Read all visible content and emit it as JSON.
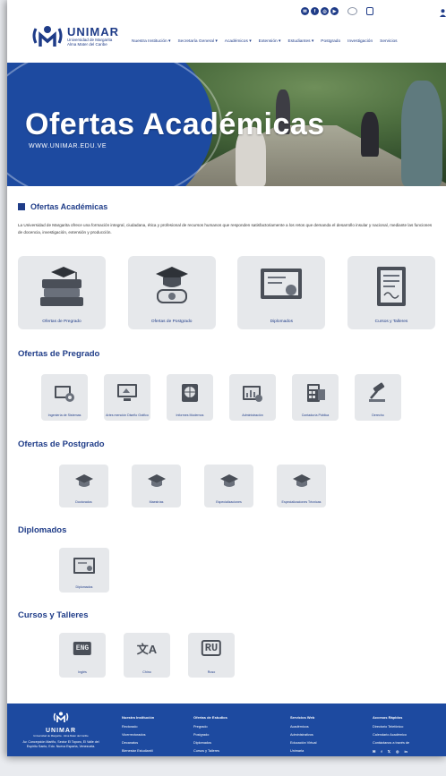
{
  "header": {
    "logo_title": "UNIMAR",
    "logo_sub1": "Universidad de Margarita",
    "logo_sub2": "Alma Mater del Caribe",
    "nav": [
      "Nuestra Institución ▾",
      "Secretaría General ▾",
      "Académicos ▾",
      "Extensión ▾",
      "Estudiantes ▾",
      "Postgrado",
      "Investigación",
      "Servicios"
    ],
    "social": [
      "✉",
      "f",
      "◎",
      "▶"
    ]
  },
  "hero": {
    "title": "Ofertas Académicas",
    "url": "WWW.UNIMAR.EDU.VE"
  },
  "main": {
    "section_title": "Ofertas Académicas",
    "intro": "La Universidad de Margarita ofrece una formación integral, ciudadana, ética y profesional de recursos humanos que responden satisfactoriamente a los retos que demanda el desarrollo insular y nacional, mediante las funciones de docencia, investigación, extensión y producción.",
    "big_cards": [
      "Ofertas de Pregrado",
      "Ofertas de Postgrado",
      "Diplomados",
      "Cursos y Talleres"
    ]
  },
  "pregrado": {
    "title": "Ofertas de Pregrado",
    "cards": [
      "Ingeniería de Sistemas",
      "Artes mención Diseño Gráfico",
      "Informes Modernos",
      "Administración",
      "Contaduría Pública",
      "Derecho"
    ]
  },
  "postgrado": {
    "title": "Ofertas de Postgrado",
    "cards": [
      "Doctorados",
      "Maestrías",
      "Especializaciones",
      "Especializaciones Técnicas"
    ]
  },
  "diplomados": {
    "title": "Diplomados",
    "cards": [
      "Diplomados"
    ]
  },
  "cursos": {
    "title": "Cursos y Talleres",
    "cards": [
      {
        "label": "Inglés",
        "glyph": "ENG"
      },
      {
        "label": "Chino",
        "glyph": "文A"
      },
      {
        "label": "Ruso",
        "glyph": "RU"
      }
    ]
  },
  "footer": {
    "name": "UNIMAR",
    "sub": "Universidad de Margarita · Alma Mater del Caribe",
    "address": "Av. Concepción Mariño, Sector El Toporo, El Valle del Espíritu Santo, Edo. Nueva Esparta, Venezuela.",
    "cols": [
      {
        "title": "Nuestra Institución",
        "items": [
          "Rectorado",
          "Vicerrectorados",
          "Decanatos",
          "Bienestar Estudiantil"
        ]
      },
      {
        "title": "Ofertas de Estudios",
        "items": [
          "Pregrado",
          "Postgrado",
          "Diplomados",
          "Cursos y Talleres"
        ]
      },
      {
        "title": "Servicios Web",
        "items": [
          "Académicos",
          "Administrativos",
          "Educación Virtual",
          "Unimarla"
        ]
      },
      {
        "title": "Accesos Rápidos",
        "items": [
          "Directorio Telefónico",
          "Calendario Académico",
          "Contáctanos a través de"
        ]
      }
    ],
    "social": [
      "✉",
      "f",
      "𝕏",
      "◎",
      "in"
    ]
  },
  "colors": {
    "brand": "#1f3c88",
    "hero_blue": "#1d4aa0",
    "card": "#e6e8eb"
  }
}
